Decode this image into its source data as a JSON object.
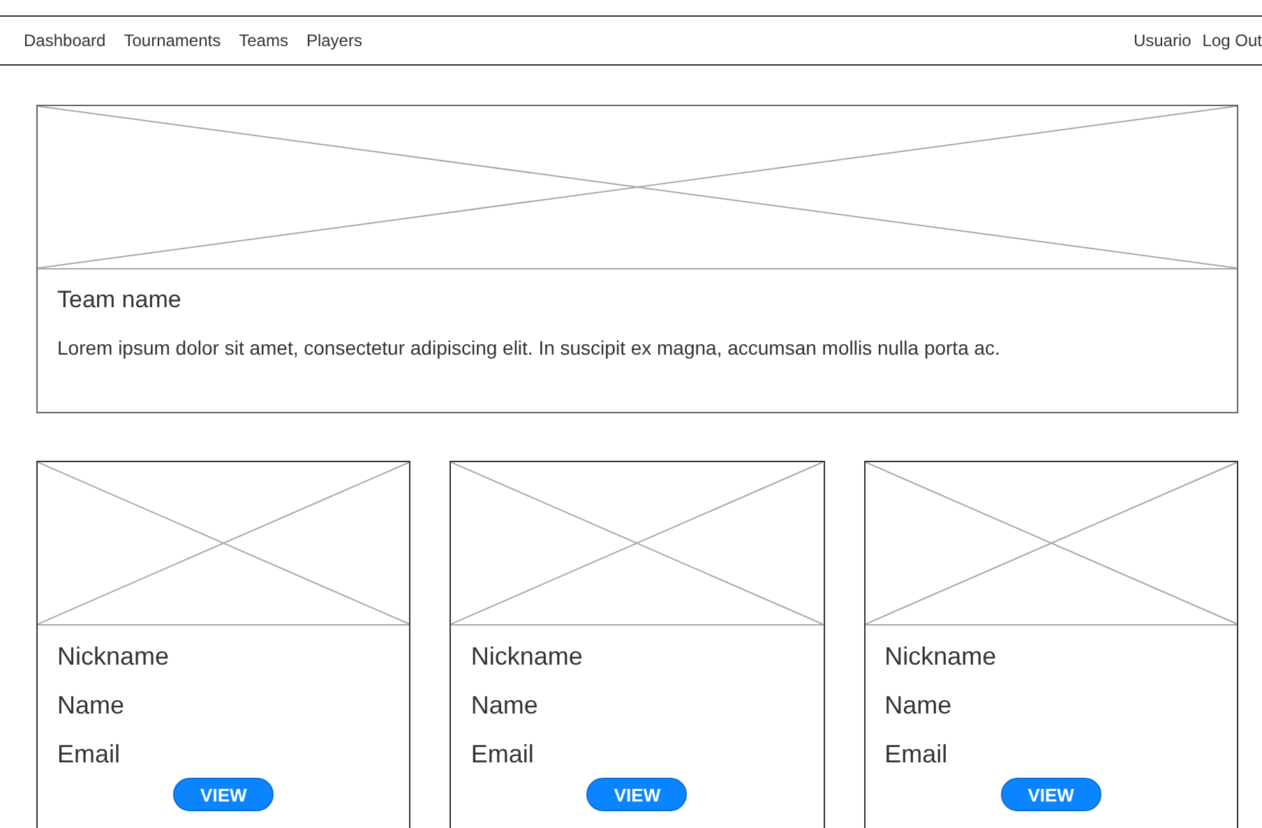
{
  "nav": {
    "links": [
      "Dashboard",
      "Tournaments",
      "Teams",
      "Players"
    ],
    "user": "Usuario",
    "logout": "Log Out"
  },
  "team": {
    "image": {
      "kind": "placeholder"
    },
    "name": "Team name",
    "description": "Lorem ipsum dolor sit amet, consectetur adipiscing elit. In suscipit ex magna, accumsan mollis nulla porta ac."
  },
  "players": [
    {
      "image": {
        "kind": "placeholder"
      },
      "nickname": "Nickname",
      "name": "Name",
      "email": "Email",
      "button": "VIEW"
    },
    {
      "image": {
        "kind": "placeholder"
      },
      "nickname": "Nickname",
      "name": "Name",
      "email": "Email",
      "button": "VIEW"
    },
    {
      "image": {
        "kind": "placeholder"
      },
      "nickname": "Nickname",
      "name": "Name",
      "email": "Email",
      "button": "VIEW"
    }
  ]
}
